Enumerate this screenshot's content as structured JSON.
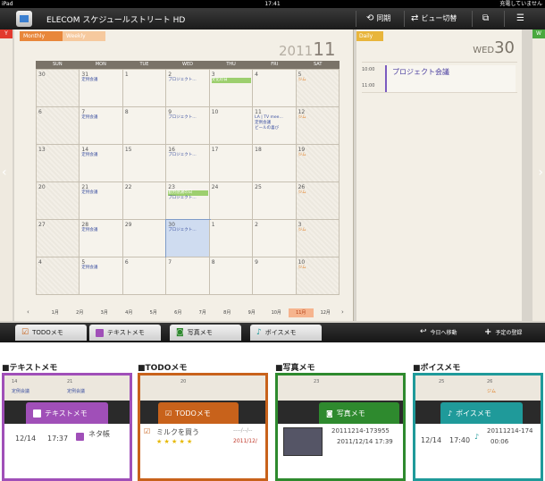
{
  "status_bar": {
    "device": "iPad",
    "time": "17:41",
    "charging": "充電していません"
  },
  "toolbar": {
    "app_title": "ELECOM スケジュールストリート HD",
    "sync_label": "同期",
    "view_switch_label": "ビュー切替"
  },
  "side_tabs": {
    "left": "Y",
    "right": "W"
  },
  "monthly": {
    "tab_monthly": "Monthly",
    "tab_weekly": "Weekly",
    "year": "2011",
    "month": "11",
    "weekdays": [
      "SUN",
      "MON",
      "TUE",
      "WED",
      "THU",
      "FRI",
      "SAT"
    ],
    "weeks": [
      [
        {
          "n": "30",
          "other": true,
          "events": []
        },
        {
          "n": "31",
          "other": true,
          "events": [
            {
              "t": "定例会議",
              "c": "blue"
            }
          ]
        },
        {
          "n": "1",
          "events": []
        },
        {
          "n": "2",
          "events": [
            {
              "t": "プロジェクト…",
              "c": "blue"
            }
          ]
        },
        {
          "n": "3",
          "events": [
            {
              "t": "文化の日",
              "c": "green"
            }
          ]
        },
        {
          "n": "4",
          "events": []
        },
        {
          "n": "5",
          "events": [
            {
              "t": "ジム",
              "c": "orange"
            }
          ]
        }
      ],
      [
        {
          "n": "6",
          "events": []
        },
        {
          "n": "7",
          "events": [
            {
              "t": "定例会議",
              "c": "blue"
            }
          ]
        },
        {
          "n": "8",
          "events": []
        },
        {
          "n": "9",
          "events": [
            {
              "t": "プロジェクト…",
              "c": "blue"
            }
          ]
        },
        {
          "n": "10",
          "events": []
        },
        {
          "n": "11",
          "events": [
            {
              "t": "LA | TV mee…",
              "c": "blue"
            },
            {
              "t": "定例会議",
              "c": "blue"
            },
            {
              "t": "ビールの喜び",
              "c": "blue"
            }
          ]
        },
        {
          "n": "12",
          "events": [
            {
              "t": "ジム",
              "c": "orange"
            }
          ]
        }
      ],
      [
        {
          "n": "13",
          "events": []
        },
        {
          "n": "14",
          "events": [
            {
              "t": "定例会議",
              "c": "blue"
            }
          ]
        },
        {
          "n": "15",
          "events": []
        },
        {
          "n": "16",
          "events": [
            {
              "t": "プロジェクト…",
              "c": "blue"
            }
          ]
        },
        {
          "n": "17",
          "events": []
        },
        {
          "n": "18",
          "events": []
        },
        {
          "n": "19",
          "events": [
            {
              "t": "ジム",
              "c": "orange"
            }
          ]
        }
      ],
      [
        {
          "n": "20",
          "events": []
        },
        {
          "n": "21",
          "events": [
            {
              "t": "定例会議",
              "c": "blue"
            }
          ]
        },
        {
          "n": "22",
          "events": []
        },
        {
          "n": "23",
          "events": [
            {
              "t": "勤労感謝の日",
              "c": "green"
            },
            {
              "t": "プロジェクト…",
              "c": "blue"
            }
          ]
        },
        {
          "n": "24",
          "events": []
        },
        {
          "n": "25",
          "events": []
        },
        {
          "n": "26",
          "events": [
            {
              "t": "ジム",
              "c": "orange"
            }
          ]
        }
      ],
      [
        {
          "n": "27",
          "events": []
        },
        {
          "n": "28",
          "events": [
            {
              "t": "定例会議",
              "c": "blue"
            }
          ]
        },
        {
          "n": "29",
          "events": []
        },
        {
          "n": "30",
          "today": true,
          "events": [
            {
              "t": "プロジェクト…",
              "c": "blue"
            }
          ]
        },
        {
          "n": "1",
          "other": true,
          "events": []
        },
        {
          "n": "2",
          "other": true,
          "events": []
        },
        {
          "n": "3",
          "other": true,
          "events": [
            {
              "t": "ジム",
              "c": "orange"
            }
          ]
        }
      ],
      [
        {
          "n": "4",
          "other": true,
          "events": []
        },
        {
          "n": "5",
          "other": true,
          "events": [
            {
              "t": "定例会議",
              "c": "blue"
            }
          ]
        },
        {
          "n": "6",
          "other": true,
          "events": []
        },
        {
          "n": "7",
          "other": true,
          "events": []
        },
        {
          "n": "8",
          "other": true,
          "events": []
        },
        {
          "n": "9",
          "other": true,
          "events": []
        },
        {
          "n": "10",
          "other": true,
          "events": [
            {
              "t": "ジム",
              "c": "orange"
            }
          ]
        }
      ]
    ],
    "months": [
      "1月",
      "2月",
      "3月",
      "4月",
      "5月",
      "6月",
      "7月",
      "8月",
      "9月",
      "10月",
      "11月",
      "12月"
    ],
    "selected_month_index": 10
  },
  "daily": {
    "tab": "Daily",
    "weekday": "WED",
    "day": "30",
    "times": [
      "10:00",
      "11:00"
    ],
    "event": "プロジェクト会議"
  },
  "memobar": {
    "todo": "TODOメモ",
    "text": "テキストメモ",
    "photo": "写真メモ",
    "voice": "ボイスメモ",
    "today": "今日へ移動",
    "add": "予定の登録"
  },
  "legend": {
    "text_memo": {
      "title": "■テキストメモ",
      "cal_nums": [
        "14",
        "21"
      ],
      "cal_events": [
        "定例会議",
        "定例会議"
      ],
      "date": "12/14",
      "time": "17:37",
      "label": "ネタ帳"
    },
    "todo_memo": {
      "title": "■TODOメモ",
      "cal_nums": [
        "20"
      ],
      "item": "ミルクを買う",
      "stars": "★ ★ ★ ★ ★",
      "date_placeholder": "----/--/--",
      "date": "2011/12/"
    },
    "photo_memo": {
      "title": "■写真メモ",
      "cal_nums": [
        "23"
      ],
      "filename": "20111214-173955",
      "datetime": "2011/12/14 17:39"
    },
    "voice_memo": {
      "title": "■ボイスメモ",
      "cal_nums": [
        "25",
        "26"
      ],
      "cal_events": [
        "ジム"
      ],
      "date": "12/14",
      "time": "17:40",
      "filename": "20111214-174",
      "duration": "00:06"
    }
  },
  "colors": {
    "text_memo": "#a04fb8",
    "todo_memo": "#c8621b",
    "photo_memo": "#2e8a2e",
    "voice_memo": "#1f9a9a",
    "monthly_tab": "#e8873b",
    "daily_tab": "#e8b53b"
  }
}
